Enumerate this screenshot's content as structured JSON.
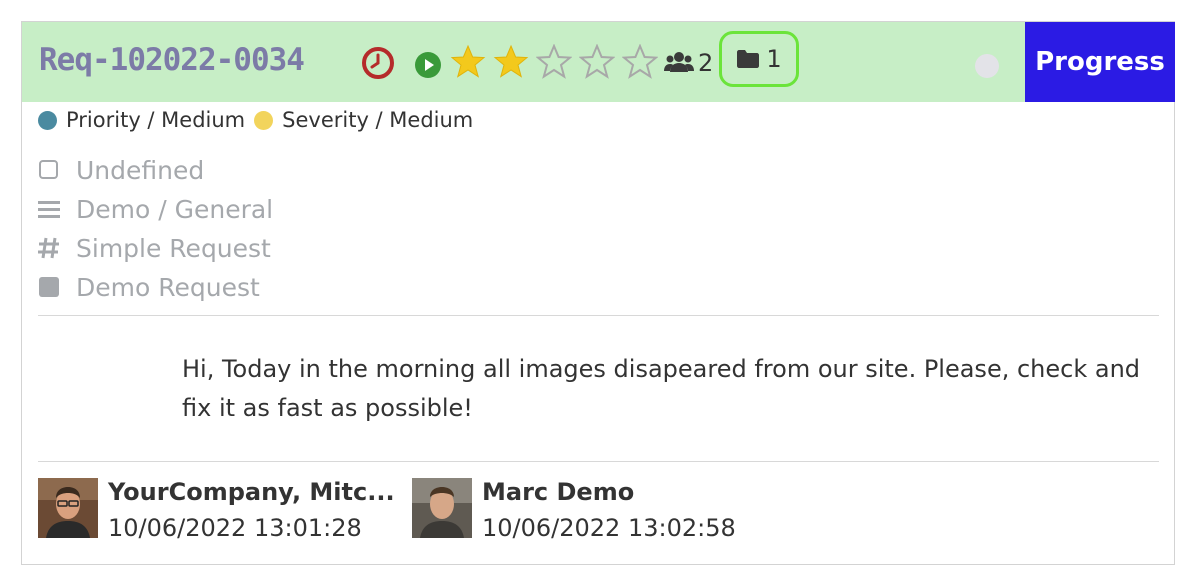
{
  "request": {
    "name": "Req-102022-0034",
    "rating_filled": 2,
    "rating_max": 5,
    "followers_count": "2",
    "documents_count": "1",
    "stage": "Progress"
  },
  "tags": {
    "priority": "Priority / Medium",
    "priority_color": "#4a8aa0",
    "severity": "Severity / Medium",
    "severity_color": "#f2d45c"
  },
  "info": {
    "deadline": "Undefined",
    "category": "Demo / General",
    "type": "Simple Request",
    "kind": "Demo Request"
  },
  "description": "Hi, Today in the morning all images disapeared from our site. Please, check and fix it as fast as possible!",
  "authors": [
    {
      "name": "YourCompany, Mitc...",
      "date": "10/06/2022 13:01:28"
    },
    {
      "name": "Marc Demo",
      "date": "10/06/2022 13:02:58"
    }
  ],
  "colors": {
    "header_bg": "#c7eec6",
    "stage_bg": "#2b1be4",
    "docs_highlight": "#6be43a",
    "clock_red": "#b52b2b",
    "play_green": "#3a9a3a",
    "star_gold": "#f3c91c"
  },
  "icons": [
    "clock-icon",
    "play-icon",
    "star-icon",
    "users-icon",
    "folder-icon",
    "checkbox-icon",
    "bars-icon",
    "hash-icon",
    "square-icon"
  ]
}
